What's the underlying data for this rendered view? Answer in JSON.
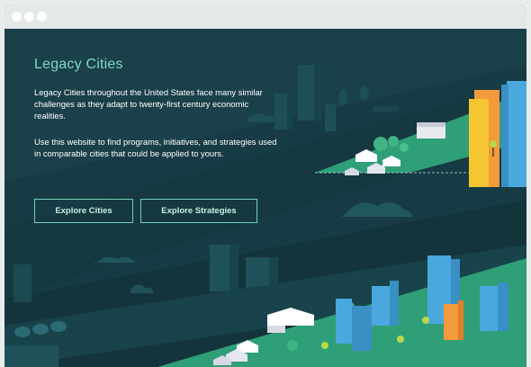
{
  "hero": {
    "title": "Legacy Cities",
    "paragraph_1": "Legacy Cities throughout the United States face many similar challenges as they adapt to twenty-first century economic realities.",
    "paragraph_2": "Use this website to find programs, initiatives, and strategies used in comparable cities that could be applied to yours."
  },
  "actions": {
    "explore_cities": "Explore Cities",
    "explore_strategies": "Explore Strategies"
  },
  "colors": {
    "background": "#173b44",
    "accent": "#7fd9c4",
    "grass": "#2f9f77",
    "building_blue": "#4aa8de",
    "building_orange": "#f39a3a",
    "building_yellow": "#f6c532"
  }
}
